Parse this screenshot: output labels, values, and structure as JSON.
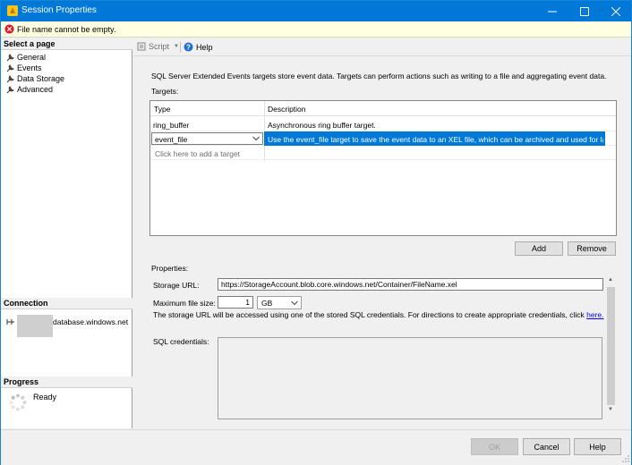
{
  "window": {
    "title": "Session Properties",
    "controls": {
      "minimize_icon": "minimize-icon",
      "maximize_icon": "maximize-icon",
      "close_icon": "close-icon"
    }
  },
  "error_banner": {
    "icon": "error-icon",
    "text": "File name cannot be empty."
  },
  "left_pane": {
    "select_page_header": "Select a page",
    "pages": [
      {
        "label": "General",
        "icon": "wrench-icon"
      },
      {
        "label": "Events",
        "icon": "wrench-icon"
      },
      {
        "label": "Data Storage",
        "icon": "wrench-icon"
      },
      {
        "label": "Advanced",
        "icon": "wrench-icon"
      }
    ],
    "connection_header": "Connection",
    "connection_server": "database.windows.net",
    "progress_header": "Progress",
    "progress_status": "Ready"
  },
  "toolbar": {
    "script_label": "Script",
    "help_label": "Help"
  },
  "main": {
    "description": "SQL Server Extended Events targets store event data. Targets can perform actions such as writing to a file and aggregating event data.",
    "targets_label": "Targets:",
    "targets_table": {
      "columns": [
        "Type",
        "Description"
      ],
      "rows": [
        {
          "type": "ring_buffer",
          "description": "Asynchronous ring buffer target."
        },
        {
          "type": "event_file",
          "description": "Use the event_file target to save the event data to an XEL file, which can be archived and used for later an..."
        }
      ],
      "add_placeholder": "Click here to add a target"
    },
    "add_button": "Add",
    "remove_button": "Remove",
    "properties_label": "Properties:",
    "storage_url_label": "Storage URL:",
    "storage_url_value": "https://StorageAccount.blob.core.windows.net/Container/FileName.xel",
    "max_file_size_label": "Maximum file size:",
    "max_file_size_value": "1",
    "max_file_size_unit": "GB",
    "note_text": "The storage URL will be accessed using one of the stored SQL credentials.  For directions to create appropriate credentials, click ",
    "note_link": "here.",
    "sql_credentials_label": "SQL credentials:"
  },
  "footer": {
    "ok_button": "OK",
    "cancel_button": "Cancel",
    "help_button": "Help"
  },
  "colors": {
    "titlebar": "#0078d7",
    "selection": "#0078d7",
    "error": "#e81123",
    "banner": "#ffffe1"
  }
}
